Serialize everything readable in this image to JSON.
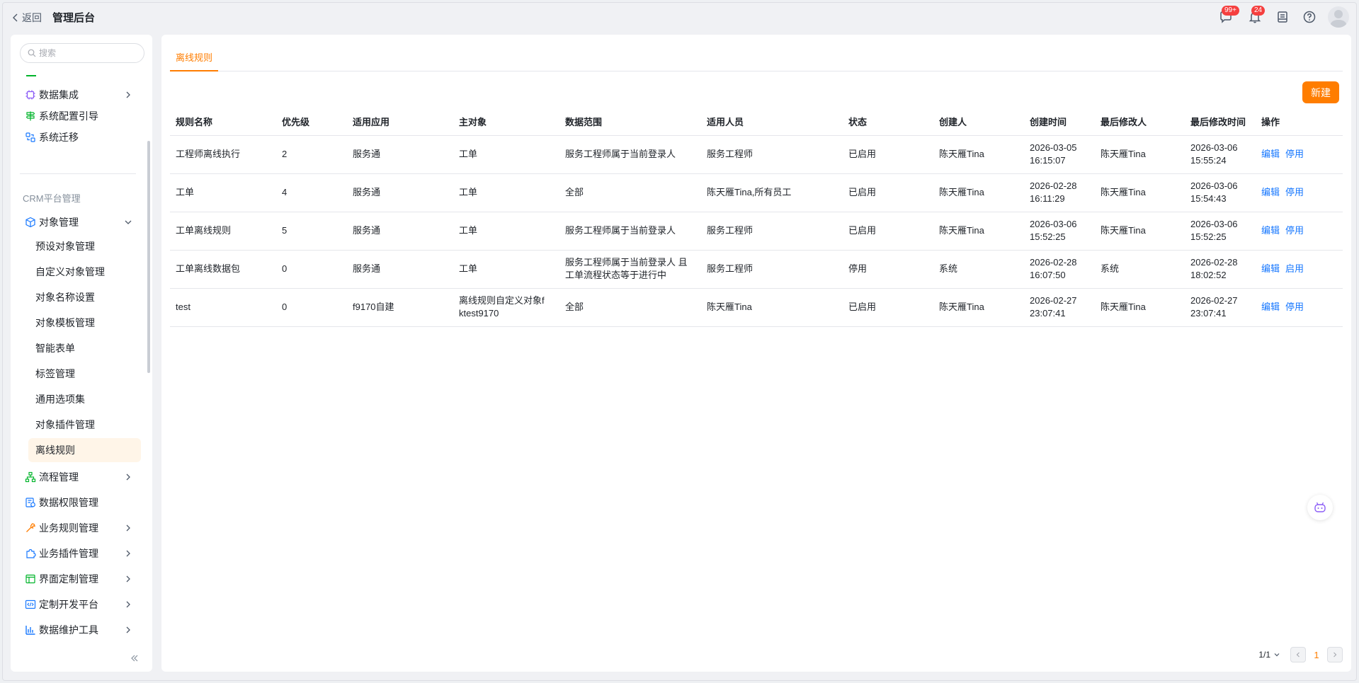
{
  "header": {
    "back_label": "返回",
    "title": "管理后台",
    "message_badge": "99+",
    "notification_badge": "24"
  },
  "sidebar": {
    "search_placeholder": "搜索",
    "top_items": [
      {
        "label": "数据集成",
        "icon": "chip-icon"
      },
      {
        "label": "系统配置引导",
        "icon": "signpost-icon"
      },
      {
        "label": "系统迁移",
        "icon": "migrate-icon"
      }
    ],
    "group_title": "CRM平台管理",
    "object_manage": {
      "label": "对象管理",
      "children": [
        "预设对象管理",
        "自定义对象管理",
        "对象名称设置",
        "对象模板管理",
        "智能表单",
        "标签管理",
        "通用选项集",
        "对象插件管理",
        "离线规则"
      ]
    },
    "bottom_items": [
      {
        "label": "流程管理",
        "icon": "flow-icon"
      },
      {
        "label": "数据权限管理",
        "icon": "permission-icon"
      },
      {
        "label": "业务规则管理",
        "icon": "wrench-icon"
      },
      {
        "label": "业务插件管理",
        "icon": "puzzle-icon"
      },
      {
        "label": "界面定制管理",
        "icon": "layout-icon"
      },
      {
        "label": "定制开发平台",
        "icon": "code-icon"
      },
      {
        "label": "数据维护工具",
        "icon": "bar-chart-icon"
      }
    ]
  },
  "main": {
    "tab_label": "离线规则",
    "new_button": "新建",
    "columns": [
      "规则名称",
      "优先级",
      "适用应用",
      "主对象",
      "数据范围",
      "适用人员",
      "状态",
      "创建人",
      "创建时间",
      "最后修改人",
      "最后修改时间",
      "操作"
    ],
    "rows": [
      {
        "name": "工程师离线执行",
        "priority": "2",
        "app": "服务通",
        "object": "工单",
        "scope": "服务工程师属于当前登录人",
        "users": "服务工程师",
        "status": "已启用",
        "creator": "陈天雁Tina",
        "created_date": "2026-03-05",
        "created_time": "16:15:07",
        "modifier": "陈天雁Tina",
        "modified_date": "2026-03-06",
        "modified_time": "15:55:24",
        "op1": "编辑",
        "op2": "停用"
      },
      {
        "name": "工单",
        "priority": "4",
        "app": "服务通",
        "object": "工单",
        "scope": "全部",
        "users": "陈天雁Tina,所有员工",
        "status": "已启用",
        "creator": "陈天雁Tina",
        "created_date": "2026-02-28",
        "created_time": "16:11:29",
        "modifier": "陈天雁Tina",
        "modified_date": "2026-03-06",
        "modified_time": "15:54:43",
        "op1": "编辑",
        "op2": "停用"
      },
      {
        "name": "工单离线规则",
        "priority": "5",
        "app": "服务通",
        "object": "工单",
        "scope": "服务工程师属于当前登录人",
        "users": "服务工程师",
        "status": "已启用",
        "creator": "陈天雁Tina",
        "created_date": "2026-03-06",
        "created_time": "15:52:25",
        "modifier": "陈天雁Tina",
        "modified_date": "2026-03-06",
        "modified_time": "15:52:25",
        "op1": "编辑",
        "op2": "停用"
      },
      {
        "name": "工单离线数据包",
        "priority": "0",
        "app": "服务通",
        "object": "工单",
        "scope": "服务工程师属于当前登录人 且 工单流程状态等于进行中",
        "users": "服务工程师",
        "status": "停用",
        "creator": "系统",
        "created_date": "2026-02-28",
        "created_time": "16:07:50",
        "modifier": "系统",
        "modified_date": "2026-02-28",
        "modified_time": "18:02:52",
        "op1": "编辑",
        "op2": "启用"
      },
      {
        "name": "test",
        "priority": "0",
        "app": "f9170自建",
        "object": "离线规则自定义对象fktest9170",
        "scope": "全部",
        "users": "陈天雁Tina",
        "status": "已启用",
        "creator": "陈天雁Tina",
        "created_date": "2026-02-27",
        "created_time": "23:07:41",
        "modifier": "陈天雁Tina",
        "modified_date": "2026-02-27",
        "modified_time": "23:07:41",
        "op1": "编辑",
        "op2": "停用"
      }
    ],
    "pager": {
      "info": "1/1",
      "current": "1"
    }
  },
  "colors": {
    "accent": "#ff7d00",
    "link": "#1677ff",
    "badge": "#f53f3f"
  }
}
